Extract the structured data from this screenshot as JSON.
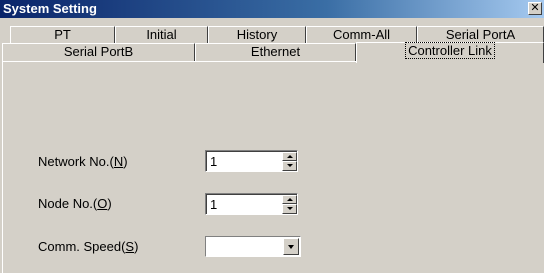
{
  "window": {
    "title": "System Setting",
    "close_label": "✕"
  },
  "tabs": {
    "row1": [
      {
        "label": "PT"
      },
      {
        "label": "Initial"
      },
      {
        "label": "History"
      },
      {
        "label": "Comm-All"
      },
      {
        "label": "Serial PortA"
      }
    ],
    "row2": [
      {
        "label": "Serial PortB"
      },
      {
        "label": "Ethernet"
      },
      {
        "label": "Controller Link"
      }
    ],
    "active": "Controller Link"
  },
  "form": {
    "network_no": {
      "label_pre": "Network No.(",
      "label_key": "N",
      "label_post": ")",
      "value": "1"
    },
    "node_no": {
      "label_pre": "Node No.(",
      "label_key": "O",
      "label_post": ")",
      "value": "1"
    },
    "comm_speed": {
      "label_pre": "Comm. Speed(",
      "label_key": "S",
      "label_post": ")",
      "value": ""
    }
  },
  "icons": {
    "close": "close-icon",
    "spin_up": "spin-up-icon",
    "spin_down": "spin-down-icon",
    "dropdown": "chevron-down-icon"
  },
  "colors": {
    "titlebar_start": "#0a246a",
    "titlebar_end": "#a6caf0",
    "face": "#d4d0c8"
  }
}
